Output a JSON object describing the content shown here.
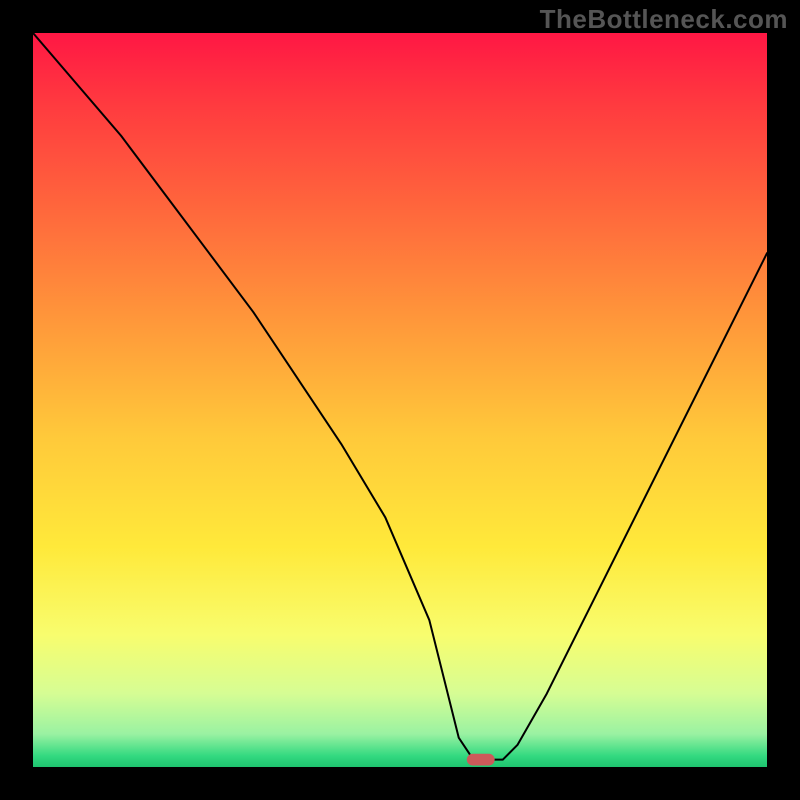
{
  "watermark": "TheBottleneck.com",
  "chart_data": {
    "type": "line",
    "title": "",
    "xlabel": "",
    "ylabel": "",
    "xlim": [
      0,
      100
    ],
    "ylim": [
      0,
      100
    ],
    "grid": false,
    "legend": false,
    "series": [
      {
        "name": "bottleneck-curve",
        "x": [
          0,
          6,
          12,
          18,
          24,
          30,
          36,
          42,
          48,
          54,
          56,
          58,
          60,
          62,
          64,
          66,
          70,
          76,
          82,
          88,
          94,
          100
        ],
        "y": [
          100,
          93,
          86,
          78,
          70,
          62,
          53,
          44,
          34,
          20,
          12,
          4,
          1,
          1,
          1,
          3,
          10,
          22,
          34,
          46,
          58,
          70
        ]
      }
    ],
    "markers": [
      {
        "name": "optimal-point",
        "x": 61,
        "y": 1,
        "color": "#cc5a5a",
        "shape": "pill"
      }
    ],
    "background_gradient": {
      "stops": [
        {
          "pos": 0.0,
          "color": "#ff1744"
        },
        {
          "pos": 0.1,
          "color": "#ff3b3f"
        },
        {
          "pos": 0.25,
          "color": "#ff6a3c"
        },
        {
          "pos": 0.4,
          "color": "#ff9a3a"
        },
        {
          "pos": 0.55,
          "color": "#ffc93a"
        },
        {
          "pos": 0.7,
          "color": "#ffe93a"
        },
        {
          "pos": 0.82,
          "color": "#f8fd6e"
        },
        {
          "pos": 0.9,
          "color": "#d6fd94"
        },
        {
          "pos": 0.955,
          "color": "#9af2a2"
        },
        {
          "pos": 0.985,
          "color": "#33d980"
        },
        {
          "pos": 1.0,
          "color": "#1ec46f"
        }
      ]
    }
  }
}
